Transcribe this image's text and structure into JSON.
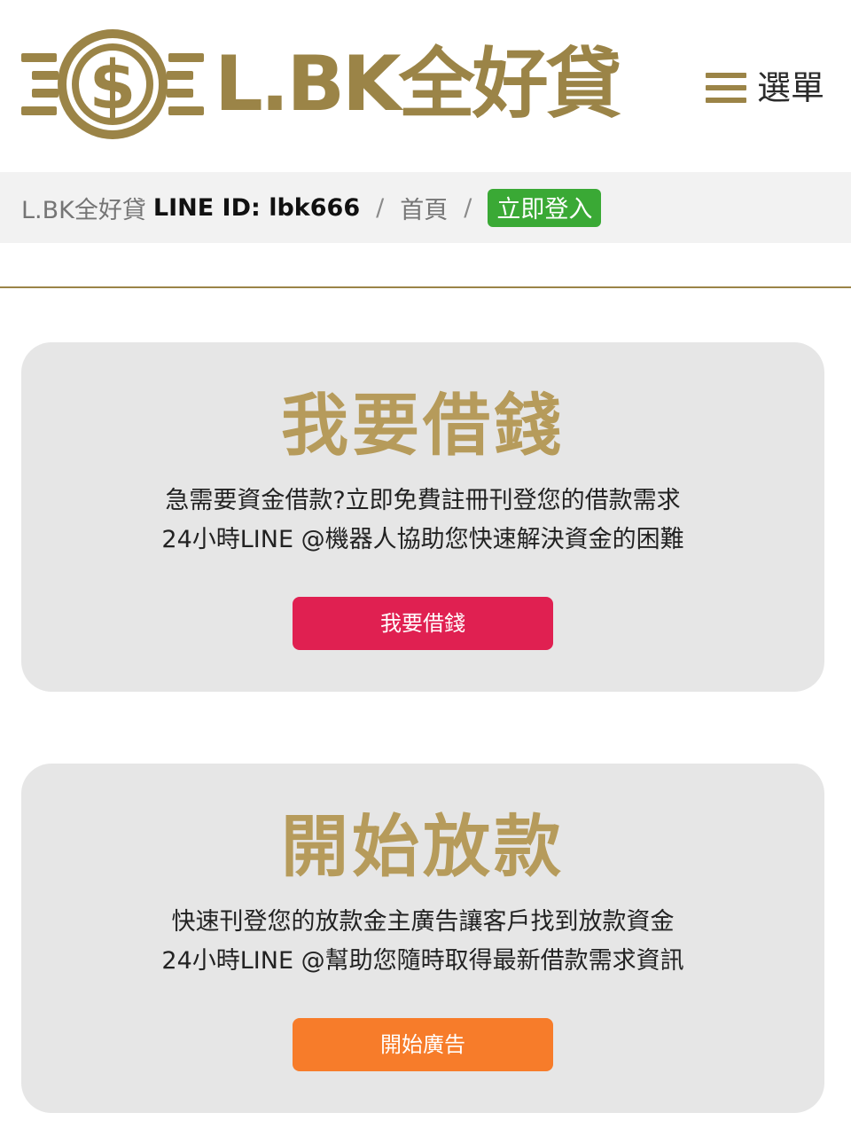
{
  "header": {
    "logo_text": "L.BK全好貸",
    "menu_label": "選單"
  },
  "breadcrumb": {
    "site": "L.BK全好貸",
    "line_id": "LINE ID: lbk666",
    "separator": "/",
    "home": "首頁",
    "login": "立即登入"
  },
  "cards": [
    {
      "title": "我要借錢",
      "line1": "急需要資金借款?立即免費註冊刊登您的借款需求",
      "line2": "24小時LINE @機器人協助您快速解決資金的困難",
      "button_label": "我要借錢",
      "button_color": "#e02051"
    },
    {
      "title": "開始放款",
      "line1": "快速刊登您的放款金主廣告讓客戶找到放款資金",
      "line2": "24小時LINE @幫助您隨時取得最新借款需求資訊",
      "button_label": "開始廣告",
      "button_color": "#f77c2a"
    }
  ],
  "colors": {
    "brand_gold": "#9b8447",
    "title_gold": "#b69b5b",
    "login_green": "#3aa935"
  },
  "icons": {
    "logo": "dollar-coin-with-wings-icon",
    "menu": "hamburger-icon"
  }
}
